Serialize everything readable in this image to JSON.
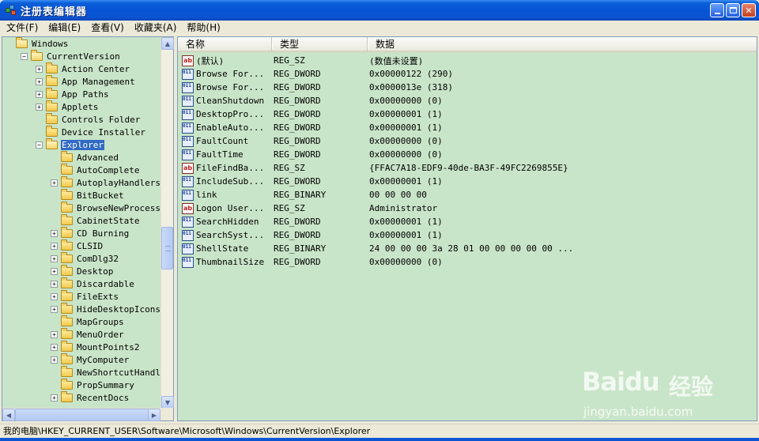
{
  "window": {
    "title": "注册表编辑器",
    "minimize": "",
    "maximize": "",
    "close": "✕"
  },
  "menu": [
    "文件(F)",
    "编辑(E)",
    "查看(V)",
    "收藏夹(A)",
    "帮助(H)"
  ],
  "tree": {
    "items": [
      {
        "label": "Windows",
        "level": 0,
        "expander": "none",
        "open": true,
        "selected": false
      },
      {
        "label": "CurrentVersion",
        "level": 1,
        "expander": "minus",
        "open": true,
        "selected": false
      },
      {
        "label": "Action Center",
        "level": 2,
        "expander": "plus",
        "open": false,
        "selected": false
      },
      {
        "label": "App Management",
        "level": 2,
        "expander": "plus",
        "open": false,
        "selected": false
      },
      {
        "label": "App Paths",
        "level": 2,
        "expander": "plus",
        "open": false,
        "selected": false
      },
      {
        "label": "Applets",
        "level": 2,
        "expander": "plus",
        "open": false,
        "selected": false
      },
      {
        "label": "Controls Folder",
        "level": 2,
        "expander": "none",
        "open": false,
        "selected": false
      },
      {
        "label": "Device Installer",
        "level": 2,
        "expander": "none",
        "open": false,
        "selected": false
      },
      {
        "label": "Explorer",
        "level": 2,
        "expander": "minus",
        "open": true,
        "selected": true
      },
      {
        "label": "Advanced",
        "level": 3,
        "expander": "none",
        "open": false,
        "selected": false
      },
      {
        "label": "AutoComplete",
        "level": 3,
        "expander": "none",
        "open": false,
        "selected": false
      },
      {
        "label": "AutoplayHandlers",
        "level": 3,
        "expander": "plus",
        "open": false,
        "selected": false
      },
      {
        "label": "BitBucket",
        "level": 3,
        "expander": "none",
        "open": false,
        "selected": false
      },
      {
        "label": "BrowseNewProcess",
        "level": 3,
        "expander": "none",
        "open": false,
        "selected": false
      },
      {
        "label": "CabinetState",
        "level": 3,
        "expander": "none",
        "open": false,
        "selected": false
      },
      {
        "label": "CD Burning",
        "level": 3,
        "expander": "plus",
        "open": false,
        "selected": false
      },
      {
        "label": "CLSID",
        "level": 3,
        "expander": "plus",
        "open": false,
        "selected": false
      },
      {
        "label": "ComDlg32",
        "level": 3,
        "expander": "plus",
        "open": false,
        "selected": false
      },
      {
        "label": "Desktop",
        "level": 3,
        "expander": "plus",
        "open": false,
        "selected": false
      },
      {
        "label": "Discardable",
        "level": 3,
        "expander": "plus",
        "open": false,
        "selected": false
      },
      {
        "label": "FileExts",
        "level": 3,
        "expander": "plus",
        "open": false,
        "selected": false
      },
      {
        "label": "HideDesktopIcons",
        "level": 3,
        "expander": "plus",
        "open": false,
        "selected": false
      },
      {
        "label": "MapGroups",
        "level": 3,
        "expander": "none",
        "open": false,
        "selected": false
      },
      {
        "label": "MenuOrder",
        "level": 3,
        "expander": "plus",
        "open": false,
        "selected": false
      },
      {
        "label": "MountPoints2",
        "level": 3,
        "expander": "plus",
        "open": false,
        "selected": false
      },
      {
        "label": "MyComputer",
        "level": 3,
        "expander": "plus",
        "open": false,
        "selected": false
      },
      {
        "label": "NewShortcutHandlers",
        "level": 3,
        "expander": "none",
        "open": false,
        "selected": false
      },
      {
        "label": "PropSummary",
        "level": 3,
        "expander": "none",
        "open": false,
        "selected": false
      },
      {
        "label": "RecentDocs",
        "level": 3,
        "expander": "plus",
        "open": false,
        "selected": false
      }
    ]
  },
  "list": {
    "columns": [
      "名称",
      "类型",
      "数据"
    ],
    "rows": [
      {
        "icon": "string-value-icon",
        "name": "(默认)",
        "type": "REG_SZ",
        "data": "(数值未设置)"
      },
      {
        "icon": "binary-value-icon",
        "name": "Browse For...",
        "type": "REG_DWORD",
        "data": "0x00000122 (290)"
      },
      {
        "icon": "binary-value-icon",
        "name": "Browse For...",
        "type": "REG_DWORD",
        "data": "0x0000013e (318)"
      },
      {
        "icon": "binary-value-icon",
        "name": "CleanShutdown",
        "type": "REG_DWORD",
        "data": "0x00000000 (0)"
      },
      {
        "icon": "binary-value-icon",
        "name": "DesktopPro...",
        "type": "REG_DWORD",
        "data": "0x00000001 (1)"
      },
      {
        "icon": "binary-value-icon",
        "name": "EnableAuto...",
        "type": "REG_DWORD",
        "data": "0x00000001 (1)"
      },
      {
        "icon": "binary-value-icon",
        "name": "FaultCount",
        "type": "REG_DWORD",
        "data": "0x00000000 (0)"
      },
      {
        "icon": "binary-value-icon",
        "name": "FaultTime",
        "type": "REG_DWORD",
        "data": "0x00000000 (0)"
      },
      {
        "icon": "string-value-icon",
        "name": "FileFindBa...",
        "type": "REG_SZ",
        "data": "{FFAC7A18-EDF9-40de-BA3F-49FC2269855E}"
      },
      {
        "icon": "binary-value-icon",
        "name": "IncludeSub...",
        "type": "REG_DWORD",
        "data": "0x00000001 (1)"
      },
      {
        "icon": "binary-value-icon",
        "name": "link",
        "type": "REG_BINARY",
        "data": "00 00 00 00"
      },
      {
        "icon": "string-value-icon",
        "name": "Logon User...",
        "type": "REG_SZ",
        "data": "Administrator"
      },
      {
        "icon": "binary-value-icon",
        "name": "SearchHidden",
        "type": "REG_DWORD",
        "data": "0x00000001 (1)"
      },
      {
        "icon": "binary-value-icon",
        "name": "SearchSyst...",
        "type": "REG_DWORD",
        "data": "0x00000001 (1)"
      },
      {
        "icon": "binary-value-icon",
        "name": "ShellState",
        "type": "REG_BINARY",
        "data": "24 00 00 00 3a 28 01 00 00 00 00 00 ..."
      },
      {
        "icon": "binary-value-icon",
        "name": "ThumbnailSize",
        "type": "REG_DWORD",
        "data": "0x00000000 (0)"
      }
    ]
  },
  "statusbar": {
    "path": "我的电脑\\HKEY_CURRENT_USER\\Software\\Microsoft\\Windows\\CurrentVersion\\Explorer"
  },
  "icons": {
    "string": "ab",
    "binary": "011 110",
    "scroll_up": "▲",
    "scroll_down": "▼",
    "scroll_left": "◀",
    "scroll_right": "▶"
  },
  "watermark": {
    "logo": "Bai",
    "logo_paw": "du",
    "cn": "经验",
    "url": "jingyan.baidu.com"
  },
  "colors": {
    "pane_background": "#c9e5c9",
    "selection": "#316ac5",
    "titlebar": "#0a55d2"
  }
}
